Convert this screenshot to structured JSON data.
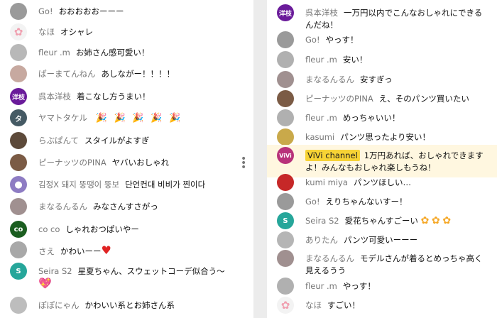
{
  "colors": {
    "owner_badge_bg": "#f7d335",
    "highlight_bg": "#fff7e0",
    "author_text": "#777777",
    "message_text": "#111111"
  },
  "left_chat": [
    {
      "avatar": "photo-gray",
      "author": "Go!",
      "text": "おおおおおーーー"
    },
    {
      "avatar": "flower-icon",
      "author": "なほ",
      "text": "オシャレ"
    },
    {
      "avatar": "photo-gray",
      "author": "fleur .m",
      "text": "お姉さん感可愛い！"
    },
    {
      "avatar": "photo-pink",
      "author": "ぱーまてんねん",
      "text": "あしながー！！！！"
    },
    {
      "avatar": "text-purple",
      "avatar_text": "洋枝",
      "author": "呉本洋枝",
      "text": "着こなし方うまい！"
    },
    {
      "avatar": "text-dark",
      "avatar_text": "タ",
      "author": "ヤマトタケル",
      "text": "",
      "emojis": [
        "party-popper-icon",
        "party-popper-icon",
        "party-popper-icon",
        "party-popper-icon",
        "party-popper-icon"
      ]
    },
    {
      "avatar": "photo-dark",
      "author": "らぶぱんて",
      "text": "スタイルがよすぎ"
    },
    {
      "avatar": "photo-brown",
      "author": "ピーナッツのPINA",
      "text": "ヤバいおしゃれ"
    },
    {
      "avatar": "person-icon",
      "author": "김정X 돼지 뚱땡이 뚱보",
      "text": "단언컨대 비비가 찐이다"
    },
    {
      "avatar": "photo-gray",
      "author": "まなるんるん",
      "text": "みなさんすさがっ"
    },
    {
      "avatar": "text-green",
      "avatar_text": "co",
      "author": "co co",
      "text": "しゃれおつぱいやー"
    },
    {
      "avatar": "photo-gray",
      "author": "さえ",
      "text": "かわいーー",
      "emojis": [
        "red-heart-icon"
      ]
    },
    {
      "avatar": "text-teal",
      "avatar_text": "S",
      "author": "Seira S2",
      "text": "星夏ちゃん、スウェットコーデ似合う〜",
      "emojis": [
        "pink-heart-icon"
      ]
    },
    {
      "avatar": "photo-gray",
      "author": "ぽぽにゃん",
      "text": "かわいい系とお姉さん系"
    }
  ],
  "right_chat": [
    {
      "avatar": "text-purple",
      "avatar_text": "洋枝",
      "author": "呉本洋枝",
      "text": "一万円以内でこんなおしゃれにできるんだね！"
    },
    {
      "avatar": "photo-gray",
      "author": "Go!",
      "text": "やっす！"
    },
    {
      "avatar": "photo-gray",
      "author": "fleur .m",
      "text": "安い！"
    },
    {
      "avatar": "photo-gray",
      "author": "まなるんるん",
      "text": "安すぎっ"
    },
    {
      "avatar": "photo-brown",
      "author": "ピーナッツのPINA",
      "text": "え、そのパンツ買いたい"
    },
    {
      "avatar": "photo-gray",
      "author": "fleur .m",
      "text": "めっちゃいい！"
    },
    {
      "avatar": "photo-yellow",
      "author": "kasumi",
      "text": "パンツ思ったより安い！"
    },
    {
      "avatar": "vivi-logo",
      "avatar_text": "ViVi",
      "author": "ViVi channel",
      "text": "1万円あれば、おしゃれできますよ！みんなもおしゃれ楽しもうね！",
      "owner": true
    },
    {
      "avatar": "photo-red",
      "author": "kumi miya",
      "text": "パンツほしい…"
    },
    {
      "avatar": "photo-gray",
      "author": "Go!",
      "text": "えりちゃんないすー！"
    },
    {
      "avatar": "text-teal",
      "avatar_text": "S",
      "author": "Seira S2",
      "text": "愛花ちゃんすごーい",
      "emojis": [
        "flower-icon",
        "flower-icon",
        "flower-icon"
      ]
    },
    {
      "avatar": "photo-gray",
      "author": "ありたん",
      "text": "パンツ可愛いーーー"
    },
    {
      "avatar": "photo-gray",
      "author": "まなるんるん",
      "text": "モデルさんが着るとめっちゃ高く見えるうう"
    },
    {
      "avatar": "photo-gray",
      "author": "fleur .m",
      "text": "やっす！"
    },
    {
      "avatar": "flower-icon",
      "author": "なほ",
      "text": "すごい！"
    }
  ]
}
